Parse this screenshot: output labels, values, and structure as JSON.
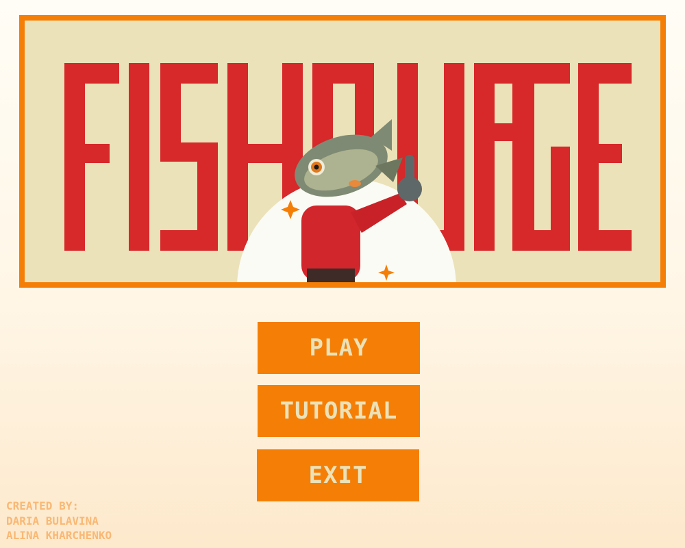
{
  "game": {
    "title": "FISHBURGER",
    "colors": {
      "frame": "#f57f06",
      "panel": "#ebe2b9",
      "title": "#d7282a",
      "button": "#f57f06",
      "button_text": "#ebe2b9",
      "credits": "#f9b874"
    }
  },
  "menu": {
    "play_label": "PLAY",
    "tutorial_label": "TUTORIAL",
    "exit_label": "EXIT"
  },
  "credits": {
    "heading": "CREATED BY:",
    "authors": [
      "DARIA BULAVINA",
      "ALINA KHARCHENKO"
    ]
  },
  "mascot": {
    "icon": "fish-mascot-icon"
  }
}
